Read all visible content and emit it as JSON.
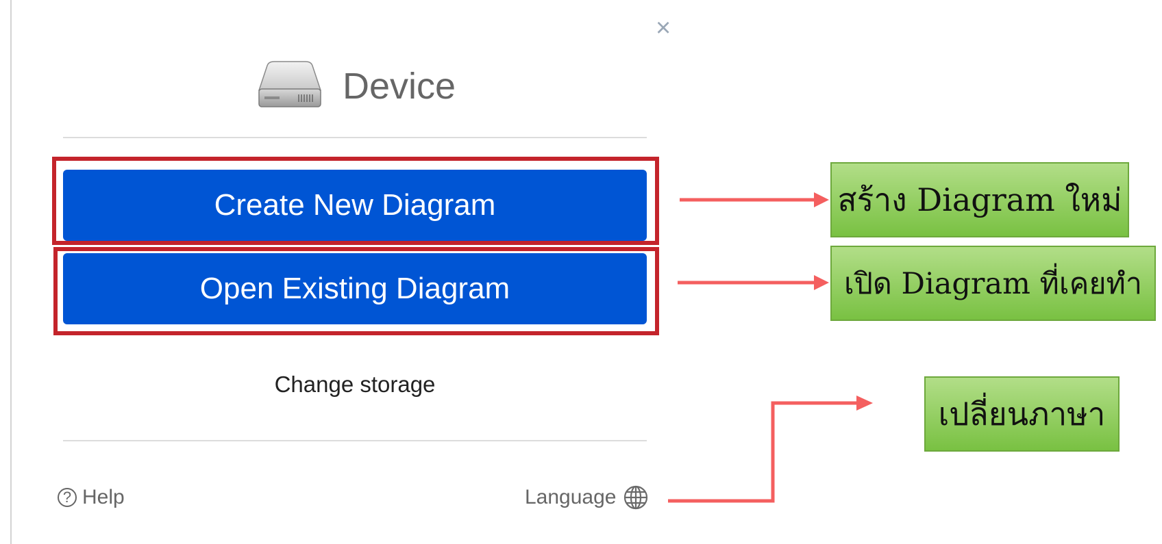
{
  "dialog": {
    "close_symbol": "×",
    "storage_title": "Device",
    "create_button": "Create New Diagram",
    "open_button": "Open Existing Diagram",
    "change_storage": "Change storage",
    "help_label": "Help",
    "help_icon_glyph": "?",
    "language_label": "Language"
  },
  "annotations": {
    "create_callout": "สร้าง Diagram ใหม่",
    "open_callout": "เปิด Diagram ที่เคยทำ",
    "language_callout": "เปลี่ยนภาษา"
  },
  "colors": {
    "button_blue": "#0055d4",
    "highlight_red": "#c4242b",
    "arrow_red": "#f45f5f",
    "callout_green": "#8dcd55"
  },
  "icons": {
    "storage": "hard-drive-icon",
    "help": "question-circle-icon",
    "language": "globe-icon",
    "close": "close-icon"
  }
}
